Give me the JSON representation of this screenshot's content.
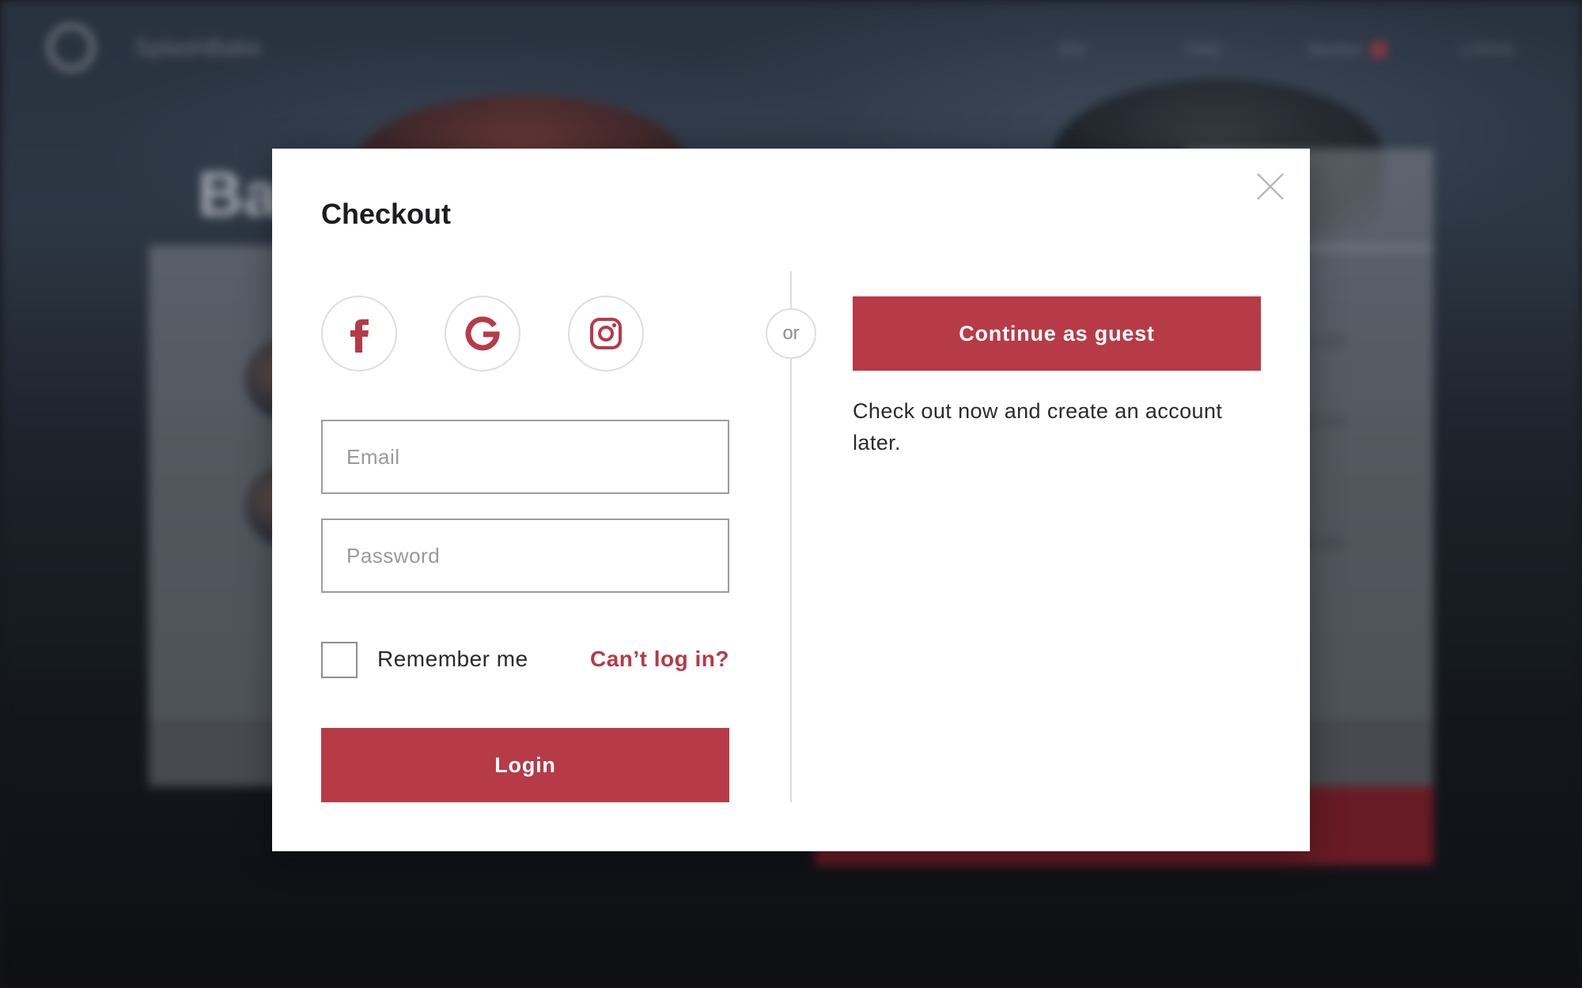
{
  "background": {
    "logo_text": "SplashBake",
    "nav": [
      "EN",
      "FAQ",
      "Basket",
      "LOGIN"
    ],
    "heading": "Ba",
    "prices": [
      "$1.40",
      "$0.54",
      "$4.85"
    ]
  },
  "modal": {
    "title": "Checkout",
    "social": [
      {
        "icon": "facebook-icon",
        "label": "Facebook"
      },
      {
        "icon": "google-icon",
        "label": "Google"
      },
      {
        "icon": "instagram-icon",
        "label": "Instagram"
      }
    ],
    "email_placeholder": "Email",
    "password_placeholder": "Password",
    "remember_label": "Remember me",
    "cant_login_label": "Can’t log in?",
    "login_label": "Login",
    "or_label": "or",
    "guest_button_label": "Continue as guest",
    "guest_description": "Check out now and create an account later."
  },
  "colors": {
    "accent": "#b73a47",
    "border": "#9d9d9d",
    "divider": "#dddddd"
  }
}
